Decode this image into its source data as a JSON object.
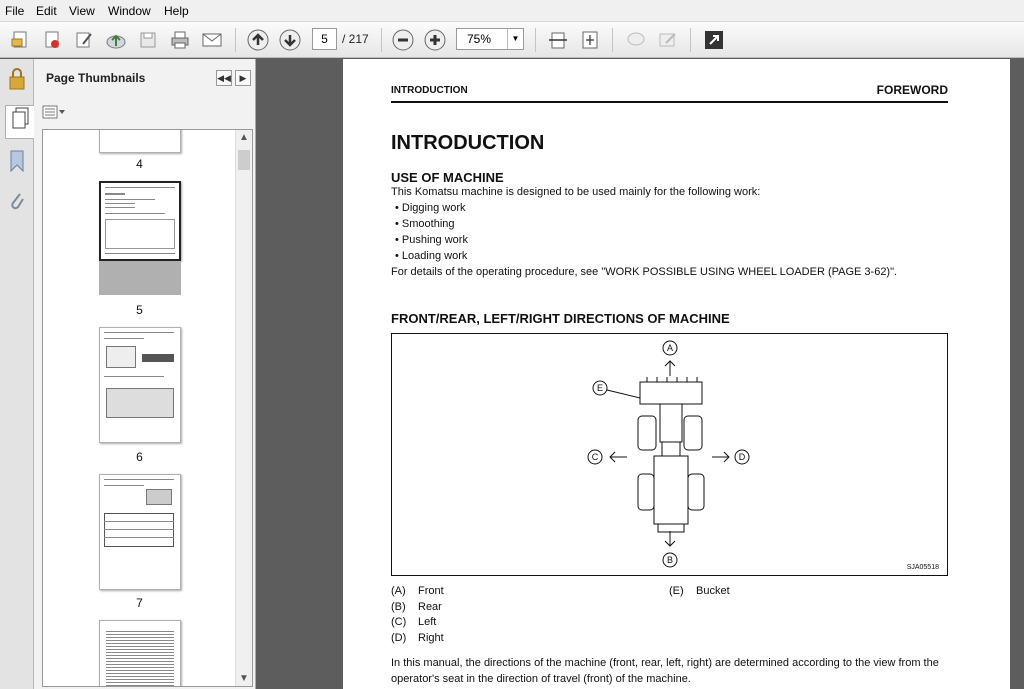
{
  "menu": [
    "File",
    "Edit",
    "View",
    "Window",
    "Help"
  ],
  "toolbar": {
    "page_current": "5",
    "page_total": "/ 217",
    "zoom": "75%"
  },
  "panel": {
    "title": "Page Thumbnails",
    "thumb_labels": [
      "4",
      "5",
      "6",
      "7"
    ]
  },
  "page": {
    "header_left": "INTRODUCTION",
    "header_right": "FOREWORD",
    "title": "INTRODUCTION",
    "section1": {
      "heading": "USE OF MACHINE",
      "intro": "This Komatsu machine is designed to be used mainly for the following work:",
      "bullets": [
        "Digging work",
        "Smoothing",
        "Pushing work",
        "Loading work"
      ],
      "details": "For details of the operating procedure, see \"WORK POSSIBLE USING WHEEL LOADER (PAGE 3-62)\"."
    },
    "section2": {
      "heading": "FRONT/REAR, LEFT/RIGHT DIRECTIONS OF MACHINE",
      "figure_id": "SJA05518",
      "markers": {
        "a": "A",
        "b": "B",
        "c": "C",
        "d": "D",
        "e": "E"
      },
      "legend": [
        {
          "key": "(A)",
          "text": "Front"
        },
        {
          "key": "(B)",
          "text": "Rear"
        },
        {
          "key": "(C)",
          "text": "Left"
        },
        {
          "key": "(D)",
          "text": "Right"
        },
        {
          "key": "(E)",
          "text": "Bucket"
        }
      ],
      "closing_line1": "In this manual, the directions of the machine (front, rear, left, right) are determined according to the view from the",
      "closing_line2": "operator's seat in the direction of travel (front) of the machine."
    }
  },
  "icons": [
    "open-icon",
    "create-pdf-icon",
    "edit-icon",
    "upload-icon",
    "save-icon",
    "print-icon",
    "email-icon",
    "prev-page-icon",
    "next-page-icon",
    "zoom-out-icon",
    "zoom-in-icon",
    "fit-width-icon",
    "fit-page-icon",
    "comment-icon",
    "sign-icon",
    "fullscreen-icon",
    "lock-icon",
    "pages-icon",
    "bookmark-icon",
    "attachment-icon"
  ]
}
